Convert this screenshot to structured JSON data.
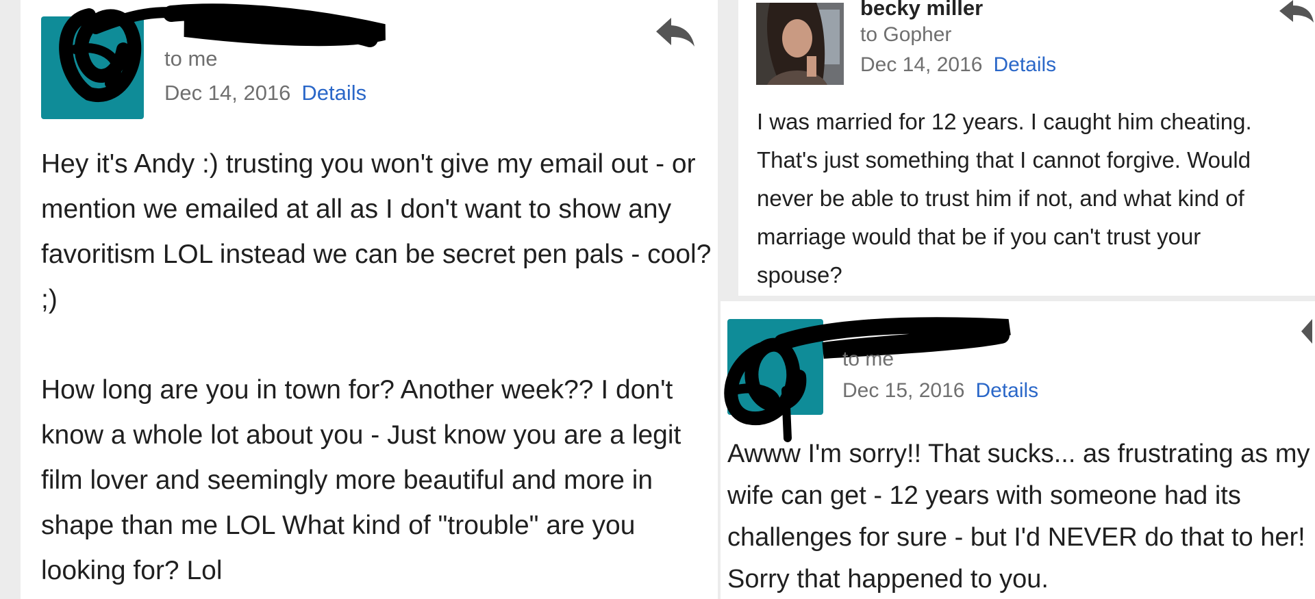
{
  "left_email": {
    "recipient": "to me",
    "date": "Dec 14, 2016",
    "details_label": "Details",
    "paragraphs": [
      "Hey it's Andy :) trusting you won't give my email out - or mention we emailed at all as I don't want to show any favoritism LOL instead we can be secret pen pals - cool? ;)",
      "How long are you in town for? Another week?? I don't know a whole lot about you - Just know you are a legit film lover and seemingly more beautiful and more in shape than me LOL What kind of \"trouble\" are you looking for? Lol"
    ]
  },
  "right_top_email": {
    "sender": "becky miller",
    "recipient": "to Gopher",
    "date": "Dec 14, 2016",
    "details_label": "Details",
    "body_lines": [
      "I was married for 12 years. I caught him cheating.",
      "That's just something that I cannot forgive. Would",
      "never be able to trust him if not, and what kind of",
      "marriage would that be if you can't trust your",
      "spouse?"
    ]
  },
  "right_bottom_email": {
    "recipient": "to me",
    "date": "Dec 15, 2016",
    "details_label": "Details",
    "body_lines": [
      "Awww I'm sorry!! That sucks... as frustrating as my",
      "wife can get - 12 years with someone had its",
      "challenges for sure - but I'd NEVER do that to her!",
      "Sorry that happened to you."
    ]
  },
  "colors": {
    "avatar_teal": "#0f8c98",
    "link_blue": "#2a67c8",
    "meta_gray": "#6f6f6f",
    "redaction": "#000000",
    "background": "#ececec"
  },
  "icons": [
    "reply-icon",
    "avatar",
    "redaction-scribble",
    "profile-photo"
  ]
}
